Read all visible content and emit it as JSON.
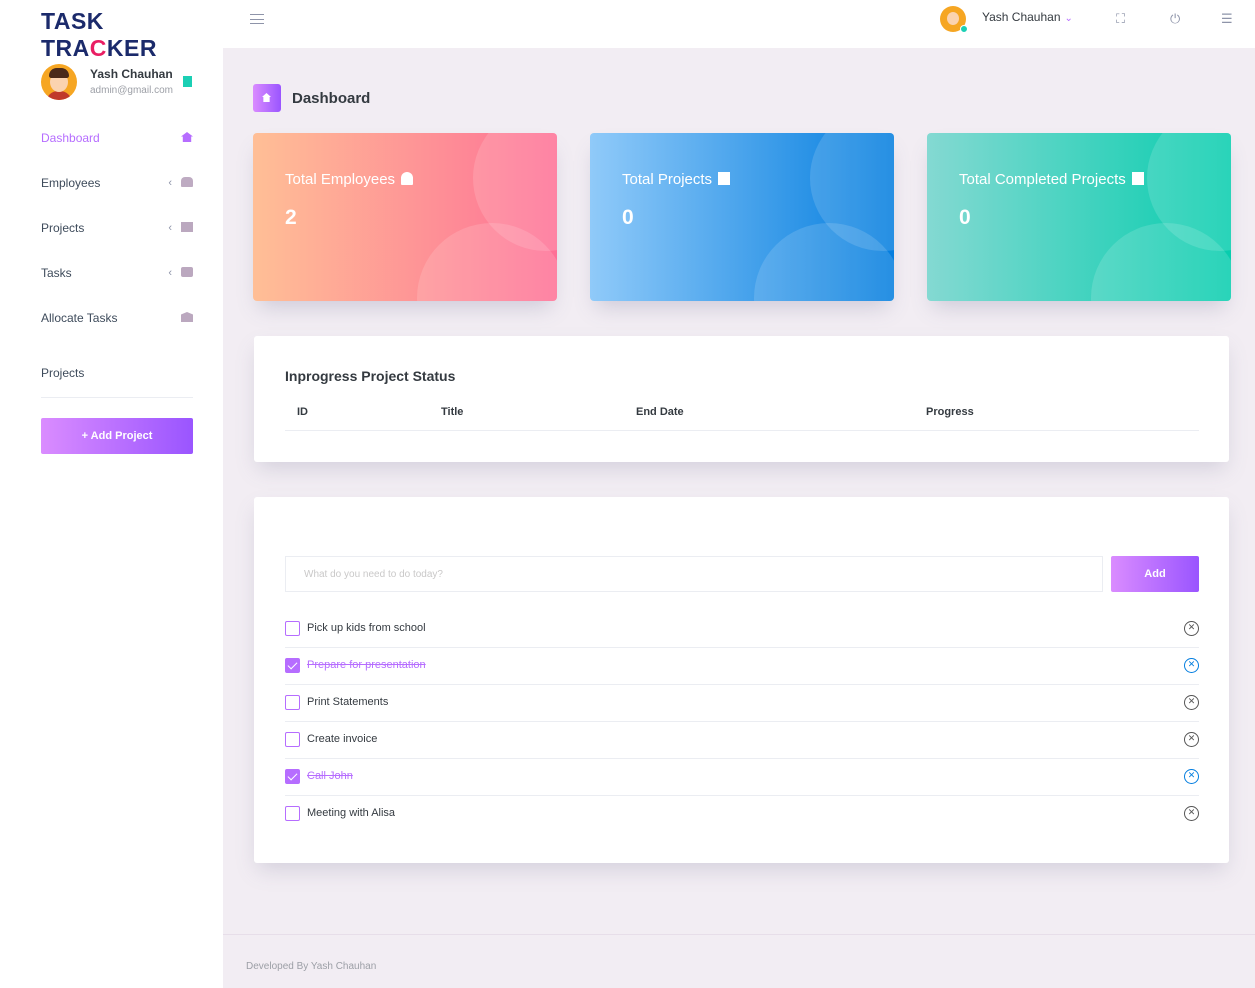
{
  "app": {
    "logo_part1": "TASK",
    "logo_part2": "TRA",
    "logo_part3": "C",
    "logo_part4": "KER"
  },
  "profile": {
    "name": "Yash Chauhan",
    "email": "admin@gmail.com"
  },
  "nav": {
    "items": [
      {
        "label": "Dashboard",
        "icon": "home-icon",
        "active": true
      },
      {
        "label": "Employees",
        "icon": "users-icon",
        "expandable": true
      },
      {
        "label": "Projects",
        "icon": "book-icon",
        "expandable": true
      },
      {
        "label": "Tasks",
        "icon": "briefcase-icon",
        "expandable": true
      },
      {
        "label": "Allocate Tasks",
        "icon": "package-icon"
      }
    ],
    "section_title": "Projects",
    "add_project_label": "+ Add Project"
  },
  "topbar": {
    "user_name": "Yash Chauhan",
    "icons": [
      "fullscreen-icon",
      "power-icon",
      "list-icon"
    ]
  },
  "page": {
    "title": "Dashboard"
  },
  "stats": [
    {
      "label": "Total Employees",
      "value": "2",
      "icon": "person-icon"
    },
    {
      "label": "Total Projects",
      "value": "0",
      "icon": "bookmark-icon"
    },
    {
      "label": "Total Completed Projects",
      "value": "0",
      "icon": "bookmark-icon"
    }
  ],
  "status_table": {
    "title": "Inprogress Project Status",
    "columns": [
      "ID",
      "Title",
      "End Date",
      "Progress"
    ]
  },
  "todo": {
    "placeholder": "What do you need to do today?",
    "add_label": "Add",
    "items": [
      {
        "text": "Pick up kids from school",
        "done": false
      },
      {
        "text": "Prepare for presentation",
        "done": true
      },
      {
        "text": "Print Statements",
        "done": false
      },
      {
        "text": "Create invoice",
        "done": false
      },
      {
        "text": "Call John",
        "done": true
      },
      {
        "text": "Meeting with Alisa",
        "done": false
      }
    ]
  },
  "footer": {
    "text": "Developed By Yash Chauhan"
  },
  "colors": {
    "accent": "#b66dff",
    "card_red": "#fe7096",
    "card_blue": "#047edf",
    "card_green": "#07cdae"
  }
}
